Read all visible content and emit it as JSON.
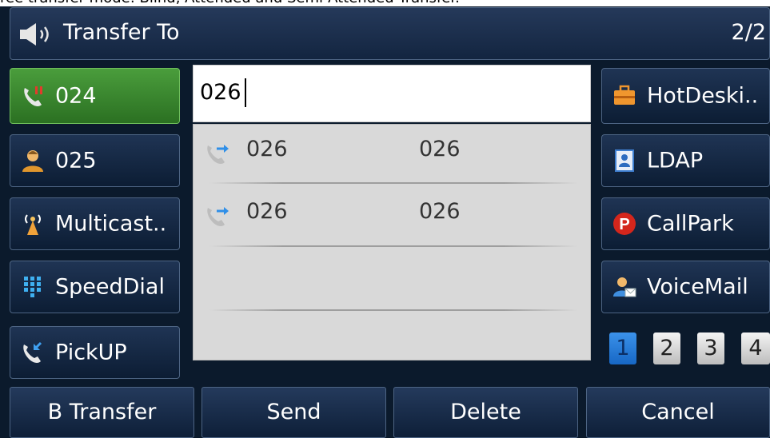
{
  "caption": "ree transfer mode: Blind, Attended and Semi-Attended Transfer.",
  "titlebar": {
    "title": "Transfer To",
    "page": "2/2",
    "icon": "speaker-icon"
  },
  "left_keys": [
    {
      "label": "024",
      "icon": "phone-missed-icon",
      "active": true
    },
    {
      "label": "025",
      "icon": "contact-icon"
    },
    {
      "label": "Multicast..",
      "icon": "antenna-icon"
    },
    {
      "label": "SpeedDial",
      "icon": "keypad-icon"
    },
    {
      "label": "PickUP",
      "icon": "pickup-call-icon"
    }
  ],
  "right_keys": [
    {
      "label": "HotDeski..",
      "icon": "briefcase-icon"
    },
    {
      "label": "LDAP",
      "icon": "directory-icon"
    },
    {
      "label": "CallPark",
      "icon": "park-icon"
    },
    {
      "label": "VoiceMail",
      "icon": "voicemail-icon"
    }
  ],
  "input": {
    "value": "026"
  },
  "results": [
    {
      "name": "026",
      "number": "026",
      "icon": "call-transfer-icon"
    },
    {
      "name": "026",
      "number": "026",
      "icon": "call-transfer-icon"
    }
  ],
  "pager": {
    "pages": [
      "1",
      "2",
      "3",
      "4"
    ],
    "current": "1"
  },
  "softkeys": [
    "B Transfer",
    "Send",
    "Delete",
    "Cancel"
  ],
  "colors": {
    "background": "#0b1a2c",
    "active_key": "#3f8f32",
    "list_bg": "#d9d9d9",
    "pager_active": "#2a7fdc"
  }
}
